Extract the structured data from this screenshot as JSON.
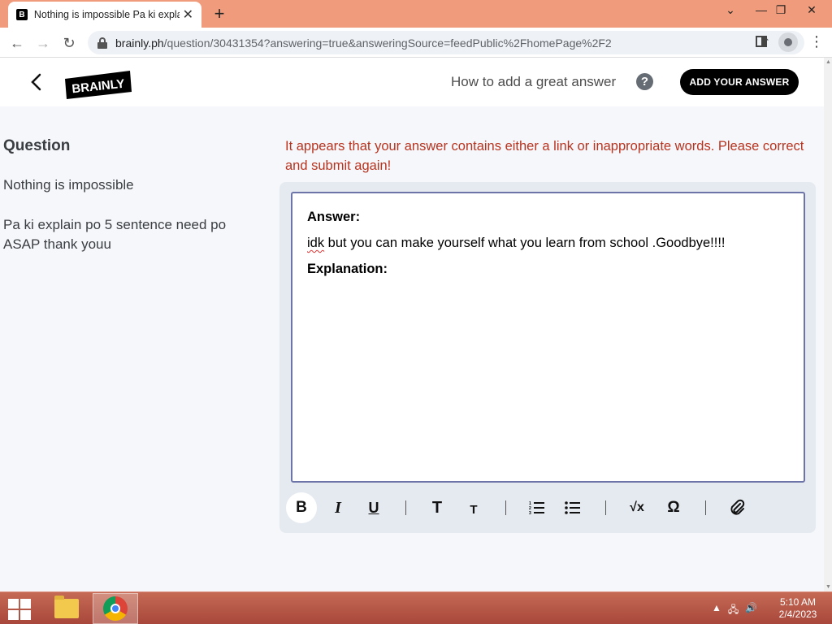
{
  "browser": {
    "tab_title": "Nothing is impossible Pa ki expla",
    "tab_favicon": "B",
    "url_host": "brainly.ph",
    "url_path": "/question/30431354?answering=true&answeringSource=feedPublic%2FhomePage%2F2",
    "icons": [
      "back-icon",
      "forward-icon",
      "reload-icon",
      "lock-icon",
      "share-icon",
      "star-icon",
      "side-panel-icon",
      "profile-icon",
      "menu-icon"
    ]
  },
  "header": {
    "logo_text": "BRAINLY",
    "help_text": "How to add a great answer",
    "help_icon_glyph": "?",
    "add_answer_label": "ADD YOUR ANSWER"
  },
  "question": {
    "heading": "Question",
    "title": "Nothing is impossible",
    "body": "Pa ki explain po 5 sentence need po ASAP thank youu"
  },
  "editor": {
    "error_message": "It appears that your answer contains either a link or inappropriate words. Please correct and submit again!",
    "answer_label": "Answer:",
    "answer_misspelled_word": "idk",
    "answer_rest": " but you can make yourself what you learn from school .Goodbye!!!!",
    "explanation_label": "Explanation:",
    "toolbar": [
      {
        "name": "bold-button",
        "glyph": "B"
      },
      {
        "name": "italic-button",
        "glyph": "I"
      },
      {
        "name": "underline-button",
        "glyph": "U"
      },
      {
        "name": "heading-large-button",
        "glyph": "T"
      },
      {
        "name": "heading-small-button",
        "glyph": "T"
      },
      {
        "name": "ordered-list-button",
        "glyph": "ordered-list-icon"
      },
      {
        "name": "bullet-list-button",
        "glyph": "bullet-list-icon"
      },
      {
        "name": "math-button",
        "glyph": "√x"
      },
      {
        "name": "symbol-button",
        "glyph": "Ω"
      },
      {
        "name": "attachment-button",
        "glyph": "paperclip-icon"
      }
    ]
  },
  "taskbar": {
    "time": "5:10 AM",
    "date": "2/4/2023"
  },
  "colors": {
    "error": "#b8331f",
    "brand": "#000000",
    "tabstrip": "#f09c7c",
    "editor_border": "#6d74a8",
    "taskbar": "#b0503f"
  }
}
